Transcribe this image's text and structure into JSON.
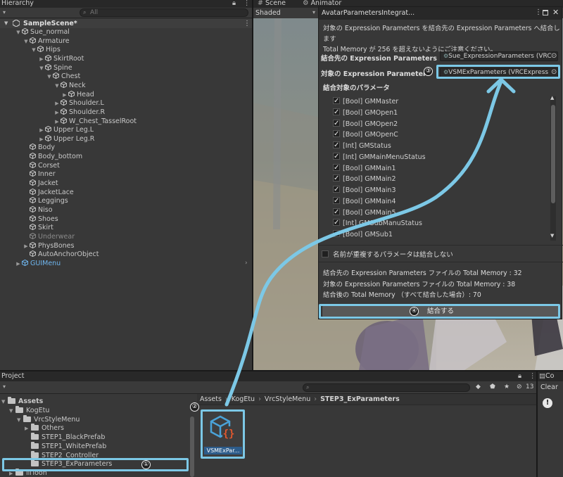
{
  "hierarchy": {
    "tab": "Hierarchy",
    "search_placeholder": "All",
    "scene": "SampleScene*",
    "items": [
      {
        "label": "Sue_normal",
        "depth": 1,
        "arrow": "▼"
      },
      {
        "label": "Armature",
        "depth": 2,
        "arrow": "▼"
      },
      {
        "label": "Hips",
        "depth": 3,
        "arrow": "▼"
      },
      {
        "label": "SkirtRoot",
        "depth": 4,
        "arrow": "▶"
      },
      {
        "label": "Spine",
        "depth": 4,
        "arrow": "▼"
      },
      {
        "label": "Chest",
        "depth": 5,
        "arrow": "▼"
      },
      {
        "label": "Neck",
        "depth": 6,
        "arrow": "▼"
      },
      {
        "label": "Head",
        "depth": 7,
        "arrow": "▶"
      },
      {
        "label": "Shoulder.L",
        "depth": 6,
        "arrow": "▶"
      },
      {
        "label": "Shoulder.R",
        "depth": 6,
        "arrow": "▶"
      },
      {
        "label": "W_Chest_TasselRoot",
        "depth": 6,
        "arrow": "▶"
      },
      {
        "label": "Upper Leg.L",
        "depth": 4,
        "arrow": "▶"
      },
      {
        "label": "Upper Leg.R",
        "depth": 4,
        "arrow": "▶"
      },
      {
        "label": "Body",
        "depth": 2,
        "arrow": ""
      },
      {
        "label": "Body_bottom",
        "depth": 2,
        "arrow": ""
      },
      {
        "label": "Corset",
        "depth": 2,
        "arrow": ""
      },
      {
        "label": "Inner",
        "depth": 2,
        "arrow": ""
      },
      {
        "label": "Jacket",
        "depth": 2,
        "arrow": ""
      },
      {
        "label": "JacketLace",
        "depth": 2,
        "arrow": ""
      },
      {
        "label": "Leggings",
        "depth": 2,
        "arrow": ""
      },
      {
        "label": "Niso",
        "depth": 2,
        "arrow": ""
      },
      {
        "label": "Shoes",
        "depth": 2,
        "arrow": ""
      },
      {
        "label": "Skirt",
        "depth": 2,
        "arrow": ""
      },
      {
        "label": "Underwear",
        "depth": 2,
        "arrow": "",
        "dim": true
      },
      {
        "label": "PhysBones",
        "depth": 2,
        "arrow": "▶"
      },
      {
        "label": "AutoAnchorObject",
        "depth": 2,
        "arrow": ""
      },
      {
        "label": "GUIMenu",
        "depth": 1,
        "arrow": "▶",
        "blue": true
      }
    ]
  },
  "scene": {
    "tab_scene": "Scene",
    "tab_animator": "Animator",
    "shading": "Shaded"
  },
  "window": {
    "title": "AvatarParametersIntegrat...",
    "description": "対象の Expression Parameters を結合先の Expression Parameters へ結合します\nTotal Memory が 256 を超えないようにご注意ください。",
    "dest_label": "結合先の Expression Parameters",
    "dest_value": "Sue_ExpressionParameters (VRC",
    "target_label": "対象の Expression Parameters",
    "target_value": "VSMExParameters (VRCExpress",
    "list_header": "結合対象のパラメータ",
    "params": [
      "[Bool] GMMaster",
      "[Bool] GMOpen1",
      "[Bool] GMOpen2",
      "[Bool] GMOpenC",
      "[Int] GMStatus",
      "[Int] GMMainMenuStatus",
      "[Bool] GMMain1",
      "[Bool] GMMain2",
      "[Bool] GMMain3",
      "[Bool] GMMain4",
      "[Bool] GMMain5",
      "[Int] GMSubManuStatus",
      "[Bool] GMSub1"
    ],
    "skip_dup_label": "名前が重複するパラメータは結合しない",
    "mem_dest": "結合先の Expression Parameters ファイルの Total Memory : 32",
    "mem_target": "対象の Expression Parameters ファイルの Total Memory : 38",
    "mem_after": "結合後の Total Memory （すべて結合した場合）: 70",
    "merge_button": "結合する"
  },
  "project": {
    "tab": "Project",
    "breadcrumb": [
      "Assets",
      "KogEtu",
      "VrcStyleMenu",
      "STEP3_ExParameters"
    ],
    "tree": [
      {
        "label": "Assets",
        "depth": 0,
        "arrow": "▼",
        "bold": true
      },
      {
        "label": "KogEtu",
        "depth": 1,
        "arrow": "▼"
      },
      {
        "label": "VrcStyleMenu",
        "depth": 2,
        "arrow": "▼"
      },
      {
        "label": "Others",
        "depth": 3,
        "arrow": "▶"
      },
      {
        "label": "STEP1_BlackPrefab",
        "depth": 3,
        "arrow": ""
      },
      {
        "label": "STEP1_WhitePrefab",
        "depth": 3,
        "arrow": ""
      },
      {
        "label": "STEP2_Controller",
        "depth": 3,
        "arrow": ""
      },
      {
        "label": "STEP3_ExParameters",
        "depth": 3,
        "arrow": ""
      },
      {
        "label": "lilToon",
        "depth": 1,
        "arrow": "▶"
      }
    ],
    "asset_name": "VSMExPar...",
    "hidden_count": "13"
  },
  "console": {
    "tab": "Co",
    "clear": "Clear"
  },
  "markers": {
    "m1": "①",
    "m2": "②",
    "m3": "③",
    "m4": "④"
  },
  "colors": {
    "highlight": "#7cc8e6",
    "arrow": "#7cc8e6",
    "panel": "#383838",
    "tabbar": "#282828"
  }
}
